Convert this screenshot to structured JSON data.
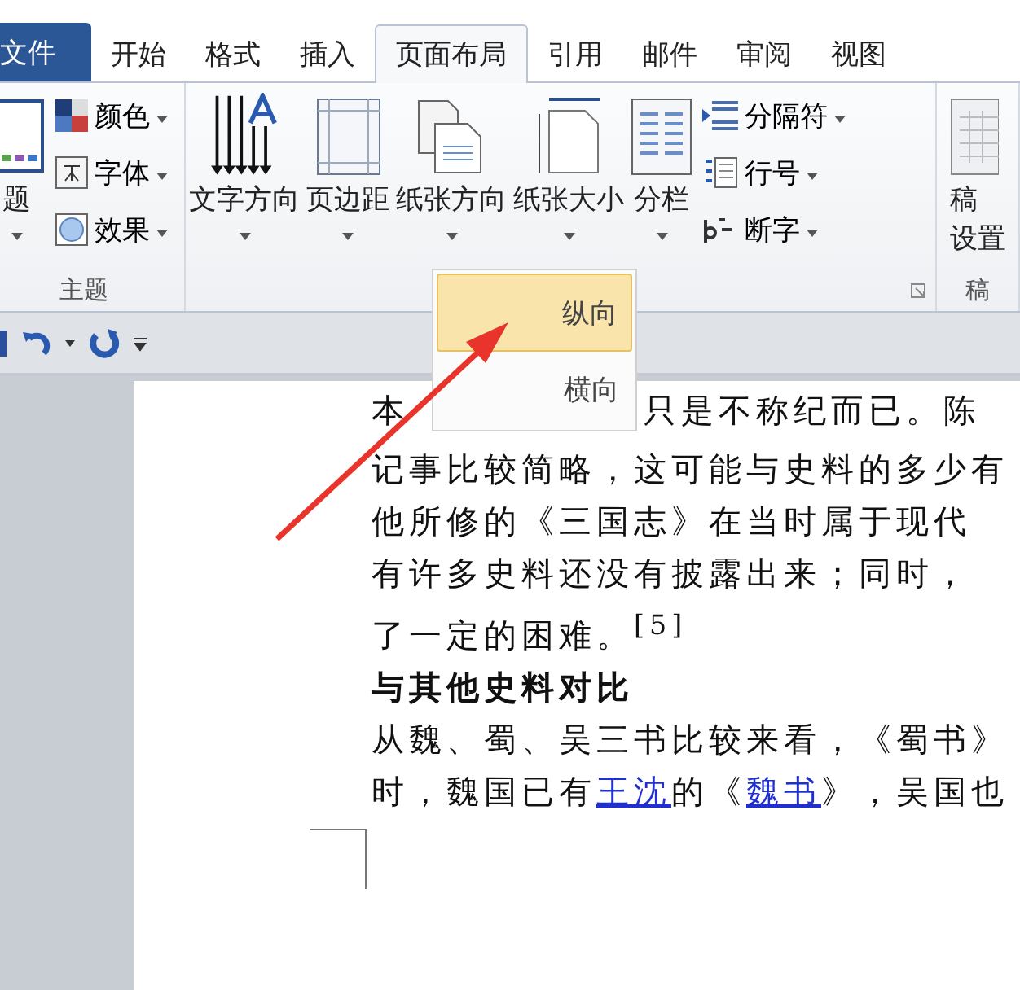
{
  "tabs": [
    {
      "label": "文件",
      "kind": "file",
      "selected": false
    },
    {
      "label": "开始",
      "kind": "tab",
      "selected": false
    },
    {
      "label": "格式",
      "kind": "tab",
      "selected": false
    },
    {
      "label": "插入",
      "kind": "tab",
      "selected": false
    },
    {
      "label": "页面布局",
      "kind": "tab",
      "selected": true
    },
    {
      "label": "引用",
      "kind": "tab",
      "selected": false
    },
    {
      "label": "邮件",
      "kind": "tab",
      "selected": false
    },
    {
      "label": "审阅",
      "kind": "tab",
      "selected": false
    },
    {
      "label": "视图",
      "kind": "tab",
      "selected": false
    }
  ],
  "theme_group": {
    "big_label": "题",
    "small": [
      {
        "label": "颜色",
        "kind": "palette"
      },
      {
        "label": "字体",
        "kind": "font"
      },
      {
        "label": "效果",
        "kind": "effect"
      }
    ],
    "label": "主题"
  },
  "page_setup_group": {
    "big": [
      {
        "label": "文字方向",
        "kind": "textdir"
      },
      {
        "label": "页边距",
        "kind": "margins"
      },
      {
        "label": "纸张方向",
        "kind": "orientation"
      },
      {
        "label": "纸张大小",
        "kind": "size"
      },
      {
        "label": "分栏",
        "kind": "columns"
      }
    ],
    "small": [
      {
        "label": "分隔符",
        "kind": "breaks"
      },
      {
        "label": "行号",
        "kind": "linenum"
      },
      {
        "label": "断字",
        "kind": "hyphen"
      }
    ]
  },
  "cut_group": {
    "lines": [
      "稿",
      "设置"
    ],
    "label": "稿"
  },
  "orientation_menu": [
    {
      "label": "纵向",
      "selected": true
    },
    {
      "label": "横向",
      "selected": false
    }
  ],
  "document": {
    "lines": [
      {
        "kind": "split",
        "parts": [
          "本",
          "只是不称纪而已。陈"
        ]
      },
      {
        "kind": "text",
        "text": "记事比较简略，这可能与史料的多少有"
      },
      {
        "kind": "text",
        "text": "他所修的《三国志》在当时属于现代"
      },
      {
        "kind": "text",
        "text": "有许多史料还没有披露出来；同时，"
      },
      {
        "kind": "text",
        "text": "了一定的困难。$^{[5]}$"
      },
      {
        "kind": "heading",
        "text": "与其他史料对比"
      },
      {
        "kind": "text",
        "text": "从魏、蜀、吴三书比较来看，《蜀书》"
      },
      {
        "kind": "links",
        "parts": [
          {
            "text": "时，魏国已有",
            "link": false
          },
          {
            "text": "王沈",
            "link": true
          },
          {
            "text": "的《",
            "link": false
          },
          {
            "text": "魏书",
            "link": true
          },
          {
            "text": "》，吴国也",
            "link": false
          }
        ]
      }
    ]
  }
}
